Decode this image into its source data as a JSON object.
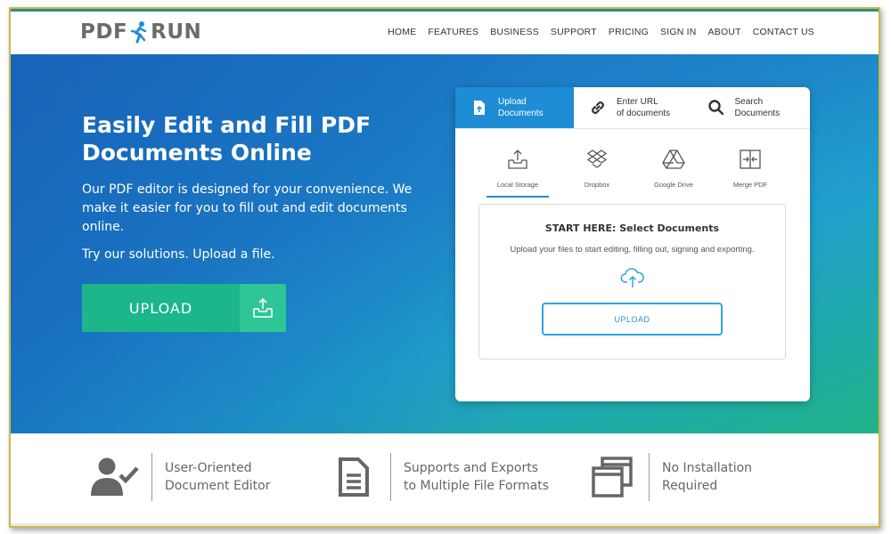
{
  "header": {
    "logo_left": "PDF",
    "logo_right": "RUN",
    "nav": [
      "HOME",
      "FEATURES",
      "BUSINESS",
      "SUPPORT",
      "PRICING",
      "SIGN IN",
      "ABOUT",
      "CONTACT US"
    ]
  },
  "hero": {
    "title": "Easily Edit and Fill PDF Documents Online",
    "description": "Our PDF editor is designed for your convenience. We make it easier for you to fill out and edit documents online.",
    "try_text": "Try our solutions. Upload a file.",
    "upload_label": "UPLOAD"
  },
  "card": {
    "tabs": [
      {
        "line1": "Upload",
        "line2": "Documents",
        "icon": "file-upload-icon"
      },
      {
        "line1": "Enter URL",
        "line2": "of documents",
        "icon": "link-icon"
      },
      {
        "line1": "Search",
        "line2": "Documents",
        "icon": "search-icon"
      }
    ],
    "sources": [
      {
        "label": "Local Storage",
        "icon": "tray-upload-icon"
      },
      {
        "label": "Dropbox",
        "icon": "dropbox-icon"
      },
      {
        "label": "Google Drive",
        "icon": "google-drive-icon"
      },
      {
        "label": "Merge PDF",
        "icon": "merge-icon"
      }
    ],
    "dropzone_title": "START HERE: Select Documents",
    "dropzone_sub": "Upload your files to start editing, filling out, signing and exporting.",
    "dropzone_button": "UPLOAD"
  },
  "features": [
    {
      "text": "User-Oriented\nDocument Editor",
      "icon": "user-check-icon"
    },
    {
      "text": "Supports and Exports\nto Multiple File Formats",
      "icon": "document-icon"
    },
    {
      "text": "No Installation\nRequired",
      "icon": "windows-stack-icon"
    }
  ],
  "colors": {
    "accent_blue": "#1f8dd6",
    "green_button": "#1bb78a",
    "border_gold": "#c9b94f"
  }
}
